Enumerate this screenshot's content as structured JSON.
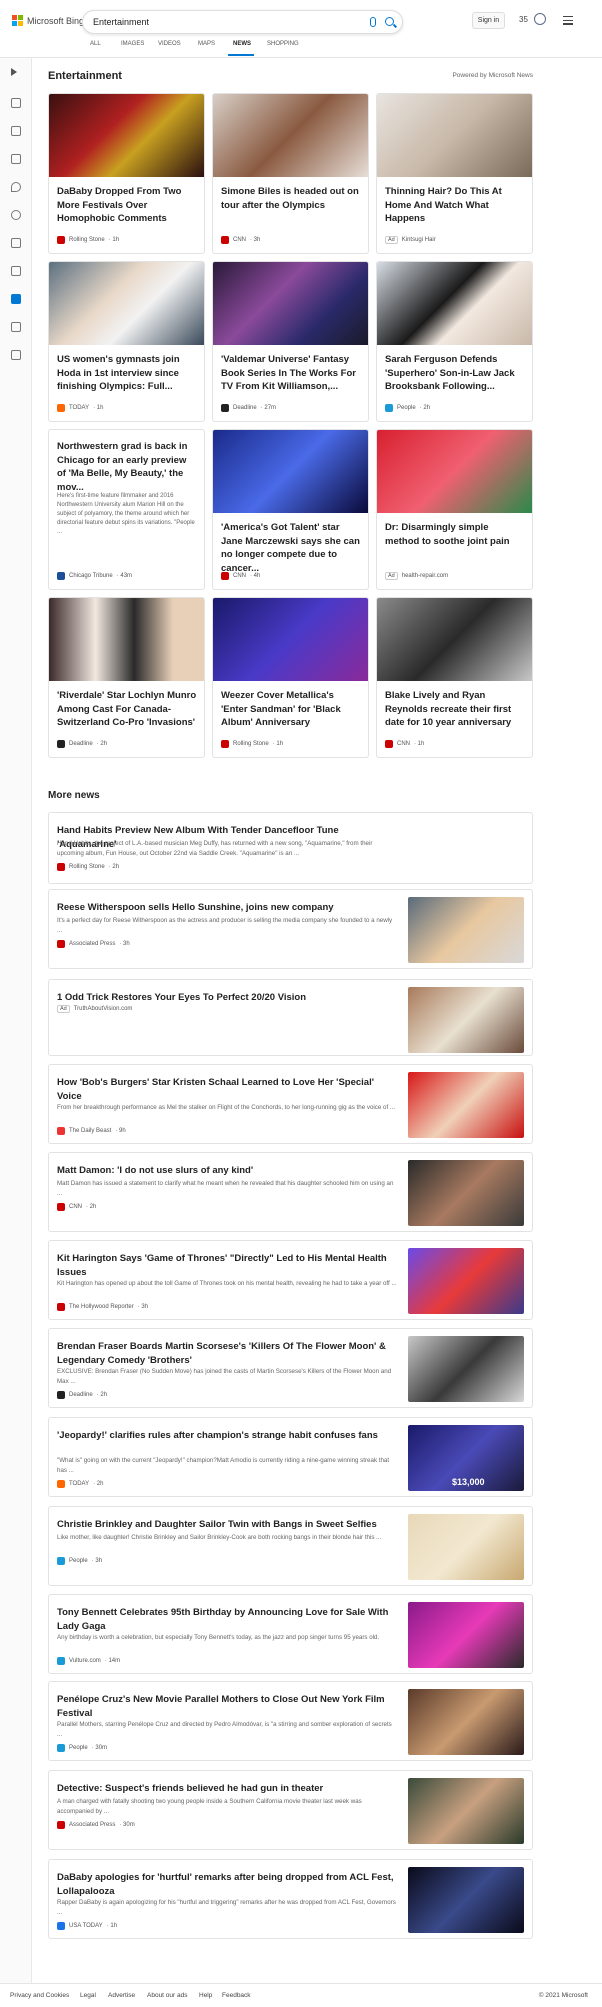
{
  "header": {
    "brand": "Microsoft Bing",
    "query": "Entertainment",
    "sign_in": "Sign in",
    "points": "35",
    "tabs": [
      "ALL",
      "IMAGES",
      "VIDEOS",
      "MAPS",
      "NEWS",
      "SHOPPING"
    ],
    "active_tab": "NEWS"
  },
  "section": {
    "title": "Entertainment",
    "powered": "Powered by Microsoft News"
  },
  "cards": [
    {
      "title": "DaBaby Dropped From Two More Festivals Over Homophobic Comments",
      "source": "Rolling Stone",
      "time": "1h",
      "color": "#c00",
      "ad": false
    },
    {
      "title": "Simone Biles is headed out on tour after the Olympics",
      "source": "CNN",
      "time": "3h",
      "color": "#c00",
      "ad": false
    },
    {
      "title": "Thinning Hair? Do This At Home And Watch What Happens",
      "source": "Kintsugi Hair",
      "time": "",
      "color": "#999",
      "ad": true
    },
    {
      "title": "US women's gymnasts join Hoda in 1st interview since finishing Olympics: Full...",
      "source": "TODAY",
      "time": "1h",
      "color": "#f60",
      "ad": false
    },
    {
      "title": "'Valdemar Universe' Fantasy Book Series In The Works For TV From Kit Williamson,...",
      "source": "Deadline",
      "time": "27m",
      "color": "#222",
      "ad": false
    },
    {
      "title": "Sarah Ferguson Defends 'Superhero' Son-in-Law Jack Brooksbank Following...",
      "source": "People",
      "time": "2h",
      "color": "#1a9bd7",
      "ad": false
    },
    {
      "title": "Northwestern grad is back in Chicago for an early preview of 'Ma Belle, My Beauty,' the mov...",
      "desc": "Here's first-time feature filmmaker and 2016 Northwestern University alum Marion Hill on the subject of polyamory, the theme around which her directorial feature debut spins its variations. \"People ...",
      "source": "Chicago Tribune",
      "time": "43m",
      "color": "#1a4f9c",
      "ad": false
    },
    {
      "title": "'America's Got Talent' star Jane Marczewski says she can no longer compete due to cancer...",
      "source": "CNN",
      "time": "4h",
      "color": "#c00",
      "ad": false
    },
    {
      "title": "Dr: Disarmingly simple method to soothe joint pain",
      "source": "health-repair.com",
      "time": "",
      "color": "#999",
      "ad": true
    },
    {
      "title": "'Riverdale' Star Lochlyn Munro Among Cast For Canada-Switzerland Co-Pro 'Invasions'",
      "source": "Deadline",
      "time": "2h",
      "color": "#222",
      "ad": false
    },
    {
      "title": "Weezer Cover Metallica's 'Enter Sandman' for 'Black Album' Anniversary",
      "source": "Rolling Stone",
      "time": "1h",
      "color": "#c00",
      "ad": false
    },
    {
      "title": "Blake Lively and Ryan Reynolds recreate their first date for 10 year anniversary",
      "source": "CNN",
      "time": "1h",
      "color": "#c00",
      "ad": false
    }
  ],
  "more_news": {
    "title": "More news",
    "items": [
      {
        "title": "Hand Habits Preview New Album With Tender Dancefloor Tune 'Aquamarine'",
        "desc": "Hand Habits, the project of L.A.-based musician Meg Duffy, has returned with a new song, \"Aquamarine,\" from their upcoming album, Fun House, out October 22nd via Saddle Creek. \"Aquamarine\" is an ...",
        "source": "Rolling Stone",
        "time": "2h",
        "color": "#c00",
        "ad": false,
        "thumb": false
      },
      {
        "title": "Reese Witherspoon sells Hello Sunshine, joins new company",
        "desc": "It's a perfect day for Reese Witherspoon as the actress and producer is selling the media company she founded to a newly ...",
        "source": "Associated Press",
        "time": "3h",
        "color": "#c00",
        "ad": false,
        "thumb": true
      },
      {
        "title": "1 Odd Trick Restores Your Eyes To Perfect 20/20 Vision",
        "desc": "",
        "source": "TruthAboutVision.com",
        "time": "",
        "color": "#999",
        "ad": true,
        "thumb": true
      },
      {
        "title": "How 'Bob's Burgers' Star Kristen Schaal Learned to Love Her 'Special' Voice",
        "desc": "From her breakthrough performance as Mel the stalker on Flight of the Conchords, to her long-running gig as the voice of ...",
        "source": "The Daily Beast",
        "time": "9h",
        "color": "#e33",
        "ad": false,
        "thumb": true
      },
      {
        "title": "Matt Damon: 'I do not use slurs of any kind'",
        "desc": "Matt Damon has issued a statement to clarify what he meant when he revealed that his daughter schooled him on using an ...",
        "source": "CNN",
        "time": "2h",
        "color": "#c00",
        "ad": false,
        "thumb": true
      },
      {
        "title": "Kit Harington Says 'Game of Thrones' \"Directly\" Led to His Mental Health Issues",
        "desc": "Kit Harington has opened up about the toll Game of Thrones took on his mental health, revealing he had to take a year off ...",
        "source": "The Hollywood Reporter",
        "time": "3h",
        "color": "#c00",
        "ad": false,
        "thumb": true
      },
      {
        "title": "Brendan Fraser Boards Martin Scorsese's 'Killers Of The Flower Moon' & Legendary Comedy 'Brothers'",
        "desc": "EXCLUSIVE: Brendan Fraser (No Sudden Move) has joined the casts of Martin Scorsese's Killers of the Flower Moon and Max ...",
        "source": "Deadline",
        "time": "2h",
        "color": "#222",
        "ad": false,
        "thumb": true
      },
      {
        "title": "'Jeopardy!' clarifies rules after champion's strange habit confuses fans",
        "desc": "\"What is\" going on with the current \"Jeopardy!\" champion?Matt Amodio is currently riding a nine-game winning streak that has ...",
        "source": "TODAY",
        "time": "2h",
        "color": "#f60",
        "ad": false,
        "thumb": true,
        "thumb_text": "$13,000"
      },
      {
        "title": "Christie Brinkley and Daughter Sailor Twin with Bangs in Sweet Selfies",
        "desc": "Like mother, like daughter! Christie Brinkley and Sailor Brinkley-Cook are both rocking bangs in their blonde hair this ...",
        "source": "People",
        "time": "3h",
        "color": "#1a9bd7",
        "ad": false,
        "thumb": true
      },
      {
        "title": "Tony Bennett Celebrates 95th Birthday by Announcing Love for Sale With Lady Gaga",
        "desc": "Any birthday is worth a celebration, but especially Tony Bennett's today, as the jazz and pop singer turns 95 years old.",
        "source": "Vulture.com",
        "time": "14m",
        "color": "#1a9bd7",
        "ad": false,
        "thumb": true
      },
      {
        "title": "Penélope Cruz's New Movie Parallel Mothers to Close Out New York Film Festival",
        "desc": "Parallel Mothers, starring Penélope Cruz and directed by Pedro Almodóvar, is \"a stirring and somber exploration of secrets ...",
        "source": "People",
        "time": "30m",
        "color": "#1a9bd7",
        "ad": false,
        "thumb": true
      },
      {
        "title": "Detective: Suspect's friends believed he had gun in theater",
        "desc": "A man charged with fatally shooting two young people inside a Southern California movie theater last week was accompanied by ...",
        "source": "Associated Press",
        "time": "30m",
        "color": "#c00",
        "ad": false,
        "thumb": true
      },
      {
        "title": "DaBaby apologies for 'hurtful' remarks after being dropped from ACL Fest, Lollapalooza",
        "desc": "Rapper DaBaby is again apologizing for his \"hurtful and triggering\" remarks after he was dropped from ACL Fest, Governors ...",
        "source": "USA TODAY",
        "time": "1h",
        "color": "#1a73e8",
        "ad": false,
        "thumb": true
      }
    ]
  },
  "footer": {
    "links": [
      "Privacy and Cookies",
      "Legal",
      "Advertise",
      "About our ads",
      "Help",
      "Feedback"
    ],
    "copyright": "© 2021 Microsoft"
  }
}
